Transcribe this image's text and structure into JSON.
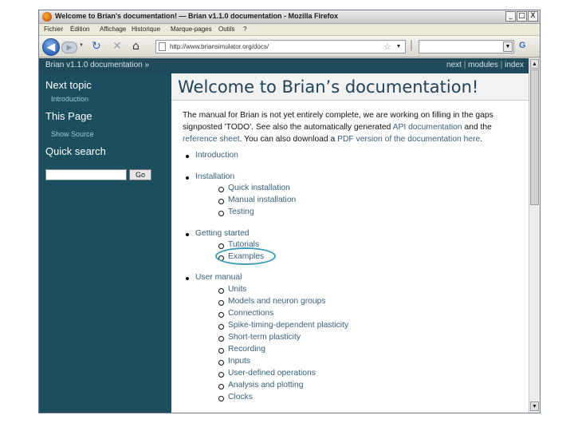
{
  "window": {
    "title": "Welcome to Brian's documentation! — Brian v1.1.0 documentation - Mozilla Firefox",
    "controls": [
      "_",
      "□",
      "X"
    ]
  },
  "menu": [
    "Fichier",
    "Édition",
    "Affichage",
    "Historique",
    "Marque-pages",
    "Outils",
    "?"
  ],
  "toolbar": {
    "url": "http://www.briansimulator.org/docs/",
    "search_value": ""
  },
  "relbar": {
    "breadcrumb": "Brian v1.1.0 documentation »",
    "next": "next",
    "modules": "modules",
    "index": "index",
    "sep": "|"
  },
  "sidebar": {
    "next_topic_heading": "Next topic",
    "next_topic_link": "Introduction",
    "this_page_heading": "This Page",
    "show_source": "Show Source",
    "quick_search_heading": "Quick search",
    "go_button": "Go"
  },
  "content": {
    "heading": "Welcome to Brian’s documentation!",
    "intro_parts": [
      "The manual for Brian is not yet entirely complete, we are working on filling in the gaps signposted 'TODO'. See also the automatically generated ",
      "API documentation",
      " and the ",
      "reference sheet",
      ". You can also download a ",
      "PDF version of the documentation here",
      "."
    ],
    "toc": [
      {
        "label": "Introduction",
        "children": []
      },
      {
        "label": "Installation",
        "children": [
          "Quick installation",
          "Manual installation",
          "Testing"
        ]
      },
      {
        "label": "Getting started",
        "children": [
          "Tutorials",
          "Examples"
        ]
      },
      {
        "label": "User manual",
        "children": [
          "Units",
          "Models and neuron groups",
          "Connections",
          "Spike-timing-dependent plasticity",
          "Short-term plasticity",
          "Recording",
          "Inputs",
          "User-defined operations",
          "Analysis and plotting",
          "Clocks"
        ]
      }
    ]
  }
}
